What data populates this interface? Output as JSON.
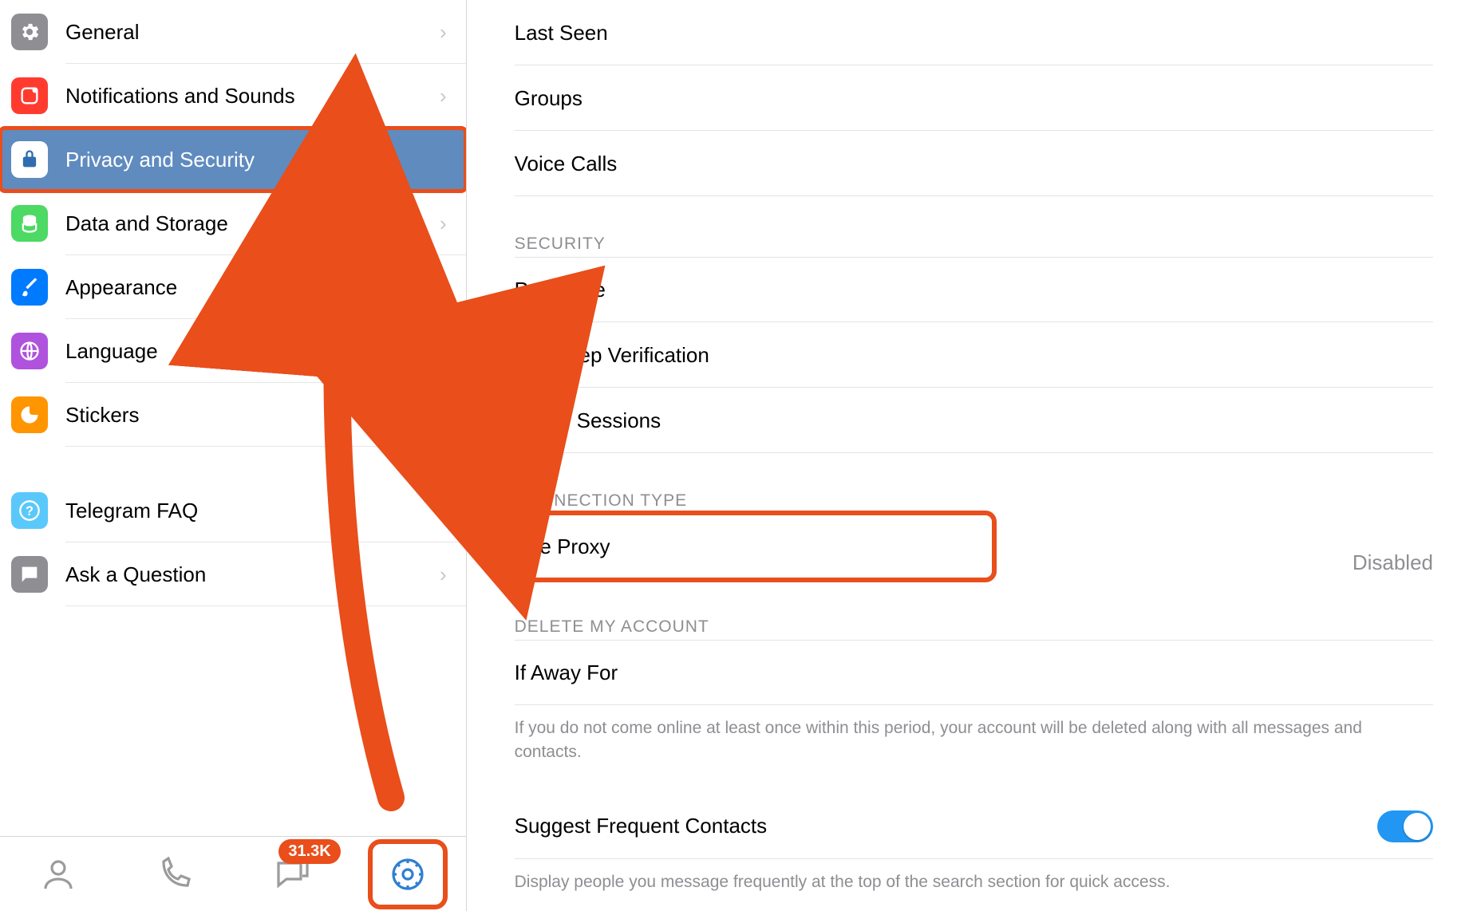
{
  "sidebar": {
    "items": [
      {
        "id": "general",
        "label": "General"
      },
      {
        "id": "notif",
        "label": "Notifications and Sounds"
      },
      {
        "id": "privacy",
        "label": "Privacy and Security"
      },
      {
        "id": "data",
        "label": "Data and Storage"
      },
      {
        "id": "appear",
        "label": "Appearance"
      },
      {
        "id": "lang",
        "label": "Language"
      },
      {
        "id": "stickers",
        "label": "Stickers"
      },
      {
        "id": "faq",
        "label": "Telegram FAQ"
      },
      {
        "id": "ask",
        "label": "Ask a Question"
      }
    ]
  },
  "tabbar": {
    "badge": "31.3K"
  },
  "content": {
    "privacy_rows": [
      {
        "label": "Last Seen"
      },
      {
        "label": "Groups"
      },
      {
        "label": "Voice Calls"
      }
    ],
    "security_header": "SECURITY",
    "security_rows": [
      {
        "label": "Passcode"
      },
      {
        "label": "Two-Step Verification"
      },
      {
        "label": "Active Sessions"
      }
    ],
    "connection_header": "CONNECTION TYPE",
    "proxy": {
      "label": "Use Proxy",
      "value": "Disabled"
    },
    "delete_header": "DELETE MY ACCOUNT",
    "if_away": {
      "label": "If Away For"
    },
    "if_away_note": "If you do not come online at least once within this period, your account will be deleted along with all messages and contacts.",
    "suggest": {
      "label": "Suggest Frequent Contacts",
      "on": true
    },
    "suggest_note": "Display people you message frequently at the top of the search section for quick access."
  },
  "annotations": {
    "highlight_color": "#e94e1b"
  }
}
